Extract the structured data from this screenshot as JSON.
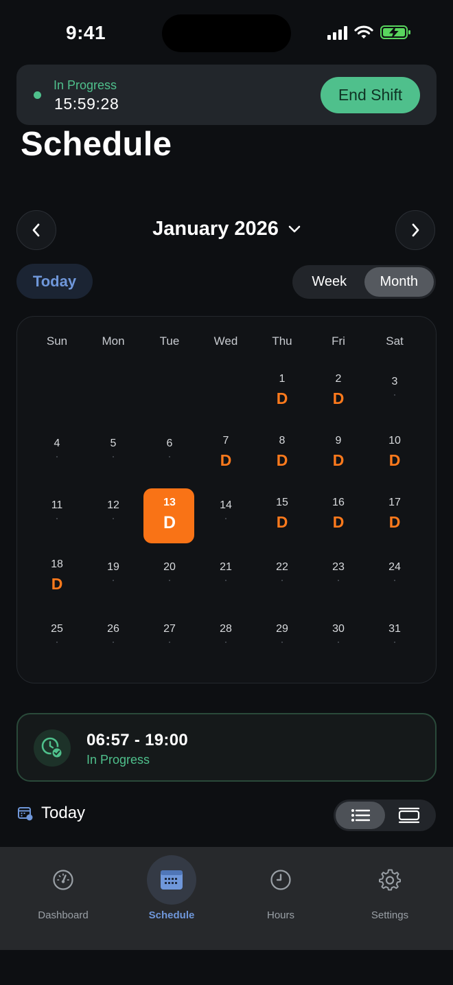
{
  "status_bar": {
    "time": "9:41"
  },
  "shift_banner": {
    "status": "In Progress",
    "timer": "15:59:28",
    "end_button": "End Shift"
  },
  "page_title": "Schedule",
  "month_nav": {
    "label": "January 2026"
  },
  "today_button": "Today",
  "view_toggle": {
    "week": "Week",
    "month": "Month",
    "selected": "Month"
  },
  "calendar": {
    "weekdays": [
      "Sun",
      "Mon",
      "Tue",
      "Wed",
      "Thu",
      "Fri",
      "Sat"
    ],
    "shift_code": "D",
    "selected_day": "13",
    "weeks": [
      [
        null,
        null,
        null,
        null,
        {
          "day": "1",
          "shift": "D"
        },
        {
          "day": "2",
          "shift": "D"
        },
        {
          "day": "3",
          "shift": ""
        }
      ],
      [
        {
          "day": "4",
          "shift": ""
        },
        {
          "day": "5",
          "shift": ""
        },
        {
          "day": "6",
          "shift": ""
        },
        {
          "day": "7",
          "shift": "D"
        },
        {
          "day": "8",
          "shift": "D"
        },
        {
          "day": "9",
          "shift": "D"
        },
        {
          "day": "10",
          "shift": "D"
        }
      ],
      [
        {
          "day": "11",
          "shift": ""
        },
        {
          "day": "12",
          "shift": ""
        },
        {
          "day": "13",
          "shift": "D"
        },
        {
          "day": "14",
          "shift": ""
        },
        {
          "day": "15",
          "shift": "D"
        },
        {
          "day": "16",
          "shift": "D"
        },
        {
          "day": "17",
          "shift": "D"
        }
      ],
      [
        {
          "day": "18",
          "shift": "D"
        },
        {
          "day": "19",
          "shift": ""
        },
        {
          "day": "20",
          "shift": ""
        },
        {
          "day": "21",
          "shift": ""
        },
        {
          "day": "22",
          "shift": ""
        },
        {
          "day": "23",
          "shift": ""
        },
        {
          "day": "24",
          "shift": ""
        }
      ],
      [
        {
          "day": "25",
          "shift": ""
        },
        {
          "day": "26",
          "shift": ""
        },
        {
          "day": "27",
          "shift": ""
        },
        {
          "day": "28",
          "shift": ""
        },
        {
          "day": "29",
          "shift": ""
        },
        {
          "day": "30",
          "shift": ""
        },
        {
          "day": "31",
          "shift": ""
        }
      ]
    ]
  },
  "shift_card": {
    "time_range": "06:57 - 19:00",
    "status": "In Progress",
    "icon": "clock-check-icon"
  },
  "list_section": {
    "title": "Today",
    "icon": "calendar-badge-icon",
    "layout_options": [
      "list-icon",
      "card-list-icon"
    ],
    "selected_layout": "list-icon"
  },
  "tab_bar": {
    "tabs": [
      {
        "label": "Dashboard",
        "icon": "gauge-icon"
      },
      {
        "label": "Schedule",
        "icon": "calendar-icon"
      },
      {
        "label": "Hours",
        "icon": "clock-icon"
      },
      {
        "label": "Settings",
        "icon": "gear-icon"
      }
    ],
    "active": "Schedule"
  },
  "colors": {
    "accent_green": "#4fc08c",
    "accent_orange": "#f97316",
    "accent_blue": "#6f97da",
    "background": "#0d0f12"
  }
}
